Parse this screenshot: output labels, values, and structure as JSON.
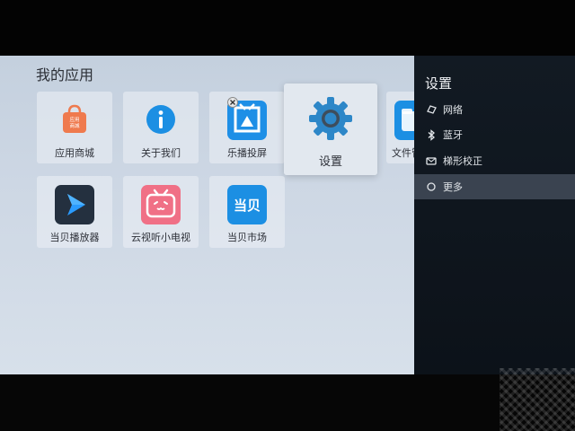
{
  "screen": {
    "title": "我的应用",
    "apps": [
      {
        "label": "应用商城",
        "icon": "app-store-bag-icon"
      },
      {
        "label": "关于我们",
        "icon": "info-icon"
      },
      {
        "label": "乐播投屏",
        "icon": "lebo-cast-icon"
      },
      {
        "label": "设置",
        "icon": "gear-icon"
      },
      {
        "label": "文件管",
        "icon": "file-manager-icon"
      },
      {
        "label": "当贝播放器",
        "icon": "dangbei-player-icon"
      },
      {
        "label": "云视听小电视",
        "icon": "bilibili-tv-icon"
      },
      {
        "label": "当贝市场",
        "icon": "dangbei-market-icon"
      }
    ],
    "store_badge_lines": [
      "应用",
      "商城"
    ],
    "market_icon_text": "当贝"
  },
  "settings_panel": {
    "title": "设置",
    "items": [
      {
        "label": "网络",
        "icon": "network-icon"
      },
      {
        "label": "蓝牙",
        "icon": "bluetooth-icon"
      },
      {
        "label": "梯形校正",
        "icon": "keystone-icon"
      },
      {
        "label": "更多",
        "icon": "more-icon",
        "selected": true
      }
    ]
  },
  "colors": {
    "accent_blue": "#1c8fe3",
    "selected_row": "#3a4350",
    "panel_bg": "#121a23",
    "bilibili_pink": "#f07086",
    "store_orange": "#ef7a4e"
  }
}
